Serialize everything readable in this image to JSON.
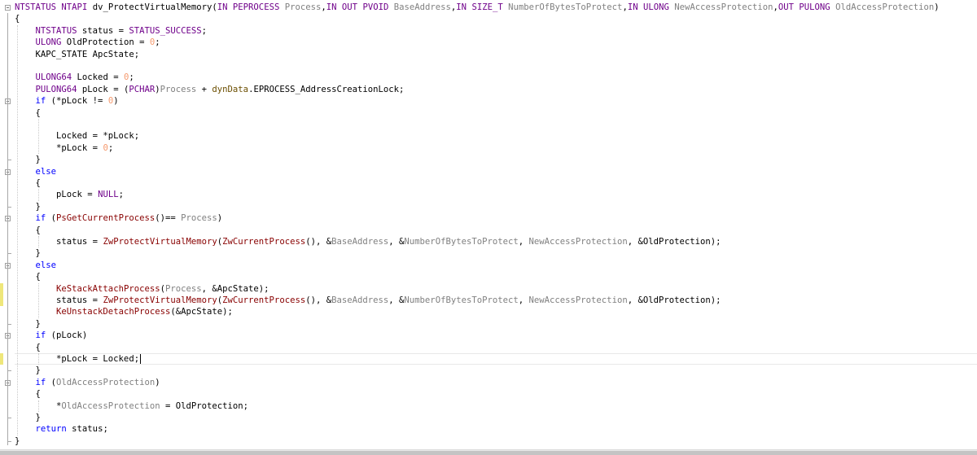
{
  "editor": {
    "lines": [
      [
        [
          "NTSTATUS",
          "macro"
        ],
        [
          " ",
          "plain"
        ],
        [
          "NTAPI",
          "macro"
        ],
        [
          " dv_ProtectVirtualMemory(",
          "plain"
        ],
        [
          "IN",
          "macro"
        ],
        [
          " ",
          "plain"
        ],
        [
          "PEPROCESS",
          "macro"
        ],
        [
          " ",
          "plain"
        ],
        [
          "Process",
          "param"
        ],
        [
          ",",
          "plain"
        ],
        [
          "IN",
          "macro"
        ],
        [
          " ",
          "plain"
        ],
        [
          "OUT",
          "macro"
        ],
        [
          " ",
          "plain"
        ],
        [
          "PVOID",
          "macro"
        ],
        [
          " ",
          "plain"
        ],
        [
          "BaseAddress",
          "param"
        ],
        [
          ",",
          "plain"
        ],
        [
          "IN",
          "macro"
        ],
        [
          " ",
          "plain"
        ],
        [
          "SIZE_T",
          "macro"
        ],
        [
          " ",
          "plain"
        ],
        [
          "NumberOfBytesToProtect",
          "param"
        ],
        [
          ",",
          "plain"
        ],
        [
          "IN",
          "macro"
        ],
        [
          " ",
          "plain"
        ],
        [
          "ULONG",
          "macro"
        ],
        [
          " ",
          "plain"
        ],
        [
          "NewAccessProtection",
          "param"
        ],
        [
          ",",
          "plain"
        ],
        [
          "OUT",
          "macro"
        ],
        [
          " ",
          "plain"
        ],
        [
          "PULONG",
          "macro"
        ],
        [
          " ",
          "plain"
        ],
        [
          "OldAccessProtection",
          "param"
        ],
        [
          ")",
          "plain"
        ]
      ],
      [
        [
          "{",
          "plain"
        ]
      ],
      [
        [
          "    ",
          "plain"
        ],
        [
          "NTSTATUS",
          "macro"
        ],
        [
          " status = ",
          "plain"
        ],
        [
          "STATUS_SUCCESS",
          "macro"
        ],
        [
          ";",
          "plain"
        ]
      ],
      [
        [
          "    ",
          "plain"
        ],
        [
          "ULONG",
          "macro"
        ],
        [
          " OldProtection = ",
          "plain"
        ],
        [
          "0",
          "num"
        ],
        [
          ";",
          "plain"
        ]
      ],
      [
        [
          "    KAPC_STATE ApcState;",
          "plain"
        ]
      ],
      [
        [
          "",
          "plain"
        ]
      ],
      [
        [
          "    ",
          "plain"
        ],
        [
          "ULONG64",
          "macro"
        ],
        [
          " Locked = ",
          "plain"
        ],
        [
          "0",
          "num"
        ],
        [
          ";",
          "plain"
        ]
      ],
      [
        [
          "    ",
          "plain"
        ],
        [
          "PULONG64",
          "macro"
        ],
        [
          " pLock = (",
          "plain"
        ],
        [
          "PCHAR",
          "macro"
        ],
        [
          ")",
          "plain"
        ],
        [
          "Process",
          "param"
        ],
        [
          " + ",
          "plain"
        ],
        [
          "dynData",
          "dyn"
        ],
        [
          ".EPROCESS_AddressCreationLock;",
          "plain"
        ]
      ],
      [
        [
          "    ",
          "plain"
        ],
        [
          "if",
          "kw"
        ],
        [
          " (*pLock != ",
          "plain"
        ],
        [
          "0",
          "num"
        ],
        [
          ")",
          "plain"
        ]
      ],
      [
        [
          "    {",
          "plain"
        ]
      ],
      [
        [
          "",
          "plain"
        ]
      ],
      [
        [
          "        Locked = *pLock;",
          "plain"
        ]
      ],
      [
        [
          "        *pLock = ",
          "plain"
        ],
        [
          "0",
          "num"
        ],
        [
          ";",
          "plain"
        ]
      ],
      [
        [
          "    }",
          "plain"
        ]
      ],
      [
        [
          "    ",
          "plain"
        ],
        [
          "else",
          "kw"
        ]
      ],
      [
        [
          "    {",
          "plain"
        ]
      ],
      [
        [
          "        pLock = ",
          "plain"
        ],
        [
          "NULL",
          "macro"
        ],
        [
          ";",
          "plain"
        ]
      ],
      [
        [
          "    }",
          "plain"
        ]
      ],
      [
        [
          "    ",
          "plain"
        ],
        [
          "if",
          "kw"
        ],
        [
          " (",
          "plain"
        ],
        [
          "PsGetCurrentProcess",
          "func"
        ],
        [
          "()== ",
          "plain"
        ],
        [
          "Process",
          "param"
        ],
        [
          ")",
          "plain"
        ]
      ],
      [
        [
          "    {",
          "plain"
        ]
      ],
      [
        [
          "        status = ",
          "plain"
        ],
        [
          "ZwProtectVirtualMemory",
          "func"
        ],
        [
          "(",
          "plain"
        ],
        [
          "ZwCurrentProcess",
          "func"
        ],
        [
          "(), &",
          "plain"
        ],
        [
          "BaseAddress",
          "param"
        ],
        [
          ", &",
          "plain"
        ],
        [
          "NumberOfBytesToProtect",
          "param"
        ],
        [
          ", ",
          "plain"
        ],
        [
          "NewAccessProtection",
          "param"
        ],
        [
          ", &OldProtection);",
          "plain"
        ]
      ],
      [
        [
          "    }",
          "plain"
        ]
      ],
      [
        [
          "    ",
          "plain"
        ],
        [
          "else",
          "kw"
        ]
      ],
      [
        [
          "    {",
          "plain"
        ]
      ],
      [
        [
          "        ",
          "plain"
        ],
        [
          "KeStackAttachProcess",
          "func"
        ],
        [
          "(",
          "plain"
        ],
        [
          "Process",
          "param"
        ],
        [
          ", &ApcState);",
          "plain"
        ]
      ],
      [
        [
          "        status = ",
          "plain"
        ],
        [
          "ZwProtectVirtualMemory",
          "func"
        ],
        [
          "(",
          "plain"
        ],
        [
          "ZwCurrentProcess",
          "func"
        ],
        [
          "(), &",
          "plain"
        ],
        [
          "BaseAddress",
          "param"
        ],
        [
          ", &",
          "plain"
        ],
        [
          "NumberOfBytesToProtect",
          "param"
        ],
        [
          ", ",
          "plain"
        ],
        [
          "NewAccessProtection",
          "param"
        ],
        [
          ", &OldProtection);",
          "plain"
        ]
      ],
      [
        [
          "        ",
          "plain"
        ],
        [
          "KeUnstackDetachProcess",
          "func"
        ],
        [
          "(&ApcState);",
          "plain"
        ]
      ],
      [
        [
          "    }",
          "plain"
        ]
      ],
      [
        [
          "    ",
          "plain"
        ],
        [
          "if",
          "kw"
        ],
        [
          " (pLock)",
          "plain"
        ]
      ],
      [
        [
          "    {",
          "plain"
        ]
      ],
      [
        [
          "        *pLock = Locked;",
          "plain"
        ]
      ],
      [
        [
          "    }",
          "plain"
        ]
      ],
      [
        [
          "    ",
          "plain"
        ],
        [
          "if",
          "kw"
        ],
        [
          " (",
          "plain"
        ],
        [
          "OldAccessProtection",
          "param"
        ],
        [
          ")",
          "plain"
        ]
      ],
      [
        [
          "    {",
          "plain"
        ]
      ],
      [
        [
          "        *",
          "plain"
        ],
        [
          "OldAccessProtection",
          "param"
        ],
        [
          " = OldProtection;",
          "plain"
        ]
      ],
      [
        [
          "    }",
          "plain"
        ]
      ],
      [
        [
          "    ",
          "plain"
        ],
        [
          "return",
          "kw"
        ],
        [
          " status;",
          "plain"
        ]
      ],
      [
        [
          "}",
          "plain"
        ]
      ]
    ],
    "folds": [
      0,
      8,
      14,
      18,
      22,
      28,
      32
    ],
    "changed_lines": [
      24,
      25,
      30
    ],
    "current_line": 30
  },
  "colors": {
    "keyword": "#0000ff",
    "macro": "#6f008a",
    "function": "#880000",
    "parameter": "#808080",
    "number": "#f59a6e",
    "change_marker": "#efe77a"
  }
}
